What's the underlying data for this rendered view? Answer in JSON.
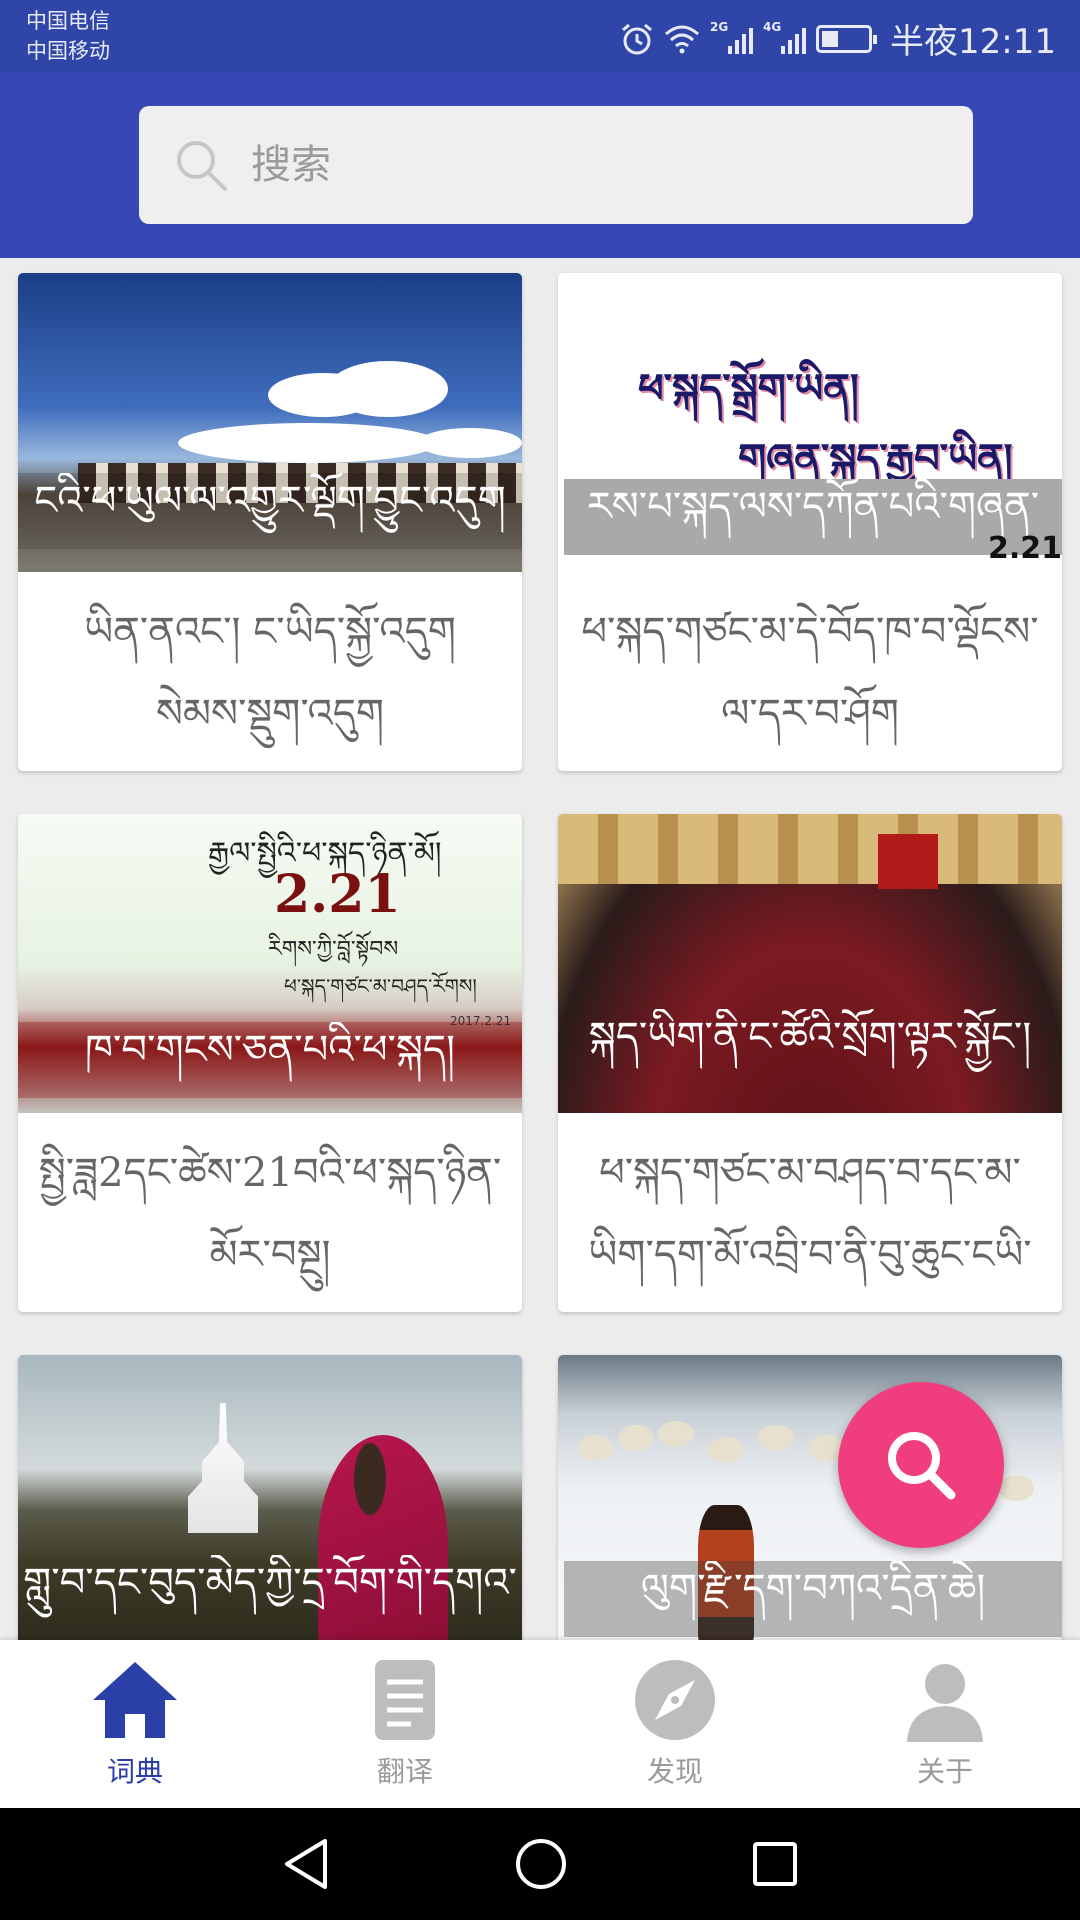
{
  "status_bar": {
    "carrier_1": "中国电信",
    "carrier_2": "中国移动",
    "signal_1_label": "2G",
    "signal_2_label": "4G",
    "time": "半夜12:11",
    "icons": [
      "alarm-icon",
      "wifi-icon",
      "signal-icon",
      "battery-icon"
    ]
  },
  "search": {
    "placeholder": "搜索"
  },
  "cards": [
    {
      "overlay": "ངའི་ཕ་ཡུལ་ལ་འགྱུར་ལྡོག་བྱུང་འདུག",
      "caption": "ཡིན་ནའང་། ང་ཡིད་སྐྱོ་འདུག སེམས་སྡུག་འདུག"
    },
    {
      "poster_line_1": "ཕ་སྐད་སྒྲོག་ཡིན།",
      "poster_line_2": "གཞན་སྐད་རྒྱབ་ཡིན།",
      "poster_number": "2.21",
      "overlay": "རས་པ་སྐད་ལས་དཀོན་པའི་གཞན་",
      "caption": "ཕ་སྐད་གཙང་མ་དེ་བོད་ཁ་བ་ལྡོངས་ ལ་དར་བ་ཤོག"
    },
    {
      "poster_line_1": "རྒྱལ་སྤྱིའི་ཕ་སྐད་ཉིན་མོ།",
      "poster_number": "2.21",
      "poster_line_2": "རིགས་ཀྱི་བློ་སྟོབས",
      "poster_line_3": "ཕ་སྐད་གཙང་མ་བཤད་རོགས།",
      "poster_date": "2017.2.21",
      "overlay": "ཁ་བ་གངས་ཅན་པའི་ཕ་སྐད།",
      "caption": "སྤྱི་ཟླ2དང་ཚེས་21བའི་ཕ་སྐད་ཉིན་ མོར་བསྔུ།"
    },
    {
      "overlay": "སྐད་ཡིག་ནི་ང་ཚོའི་སྲོག་ལྟར་སྐྱོང་།",
      "caption": "ཕ་སྐད་གཙང་མ་བཤད་བ་དང་མ་ ཡིག་དག་མོ་འབྲི་བ་ནི་བུ་ཆུང་ངཡི་རེ་"
    },
    {
      "overlay": "གླུ་བ་དང་བུད་མེད་ཀྱི་དྲ་བོག་གི་དགའ་",
      "caption": ""
    },
    {
      "overlay": "ལུག་རྫི་དག་བཀའ་དྲིན་ཆེ།",
      "caption": ""
    }
  ],
  "nav": {
    "items": [
      {
        "label": "词典",
        "icon": "home-icon",
        "active": true
      },
      {
        "label": "翻译",
        "icon": "document-icon",
        "active": false
      },
      {
        "label": "发现",
        "icon": "compass-icon",
        "active": false
      },
      {
        "label": "关于",
        "icon": "person-icon",
        "active": false
      }
    ]
  },
  "colors": {
    "status_bar": "#2f45a8",
    "header": "#3748b6",
    "fab": "#f03d7e",
    "nav_active": "#2b3fa8",
    "nav_inactive": "#9a9a9a"
  }
}
